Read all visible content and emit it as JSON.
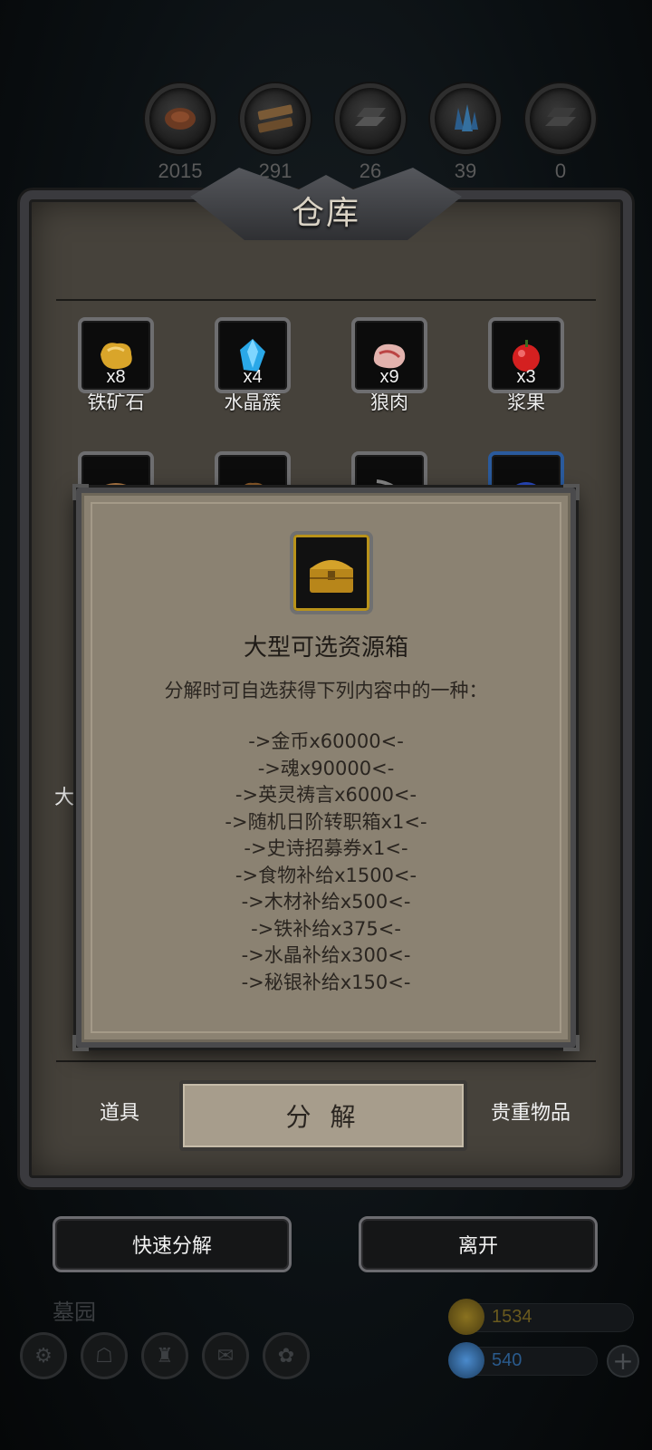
{
  "resources": [
    {
      "icon": "meat-icon",
      "count": "2015",
      "color": "#6b3a22"
    },
    {
      "icon": "wood-icon",
      "count": "291",
      "color": "#7a5a36"
    },
    {
      "icon": "iron-icon",
      "count": "26",
      "color": "#555555"
    },
    {
      "icon": "crystal-icon",
      "count": "39",
      "color": "#2b5d8c"
    },
    {
      "icon": "mithril-icon",
      "count": "0",
      "color": "#444444"
    }
  ],
  "warehouse": {
    "title": "仓库",
    "items": [
      {
        "name": "铁矿石",
        "qty": "x8",
        "icon": "iron-ore-icon",
        "color": "#d9a52a"
      },
      {
        "name": "水晶簇",
        "qty": "x4",
        "icon": "crystal-cluster-icon",
        "color": "#2aa8e8"
      },
      {
        "name": "狼肉",
        "qty": "x9",
        "icon": "wolf-meat-icon",
        "color": "#e3b3ae"
      },
      {
        "name": "浆果",
        "qty": "x3",
        "icon": "berry-icon",
        "color": "#d42020"
      }
    ],
    "partial_left_label": "大型"
  },
  "tabs": {
    "items": "道具",
    "decompose": "分 解",
    "valuables": "贵重物品"
  },
  "buttons": {
    "quick_decompose": "快速分解",
    "leave": "离开"
  },
  "footer": {
    "area_name": "墓园",
    "gold": "1534",
    "gems": "540",
    "plus": "+"
  },
  "modal": {
    "icon": "treasure-chest-icon",
    "title": "大型可选资源箱",
    "description": "分解时可自选获得下列内容中的一种：",
    "options": [
      "->金币x60000<-",
      "->魂x90000<-",
      "->英灵祷言x6000<-",
      "->随机日阶转职箱x1<-",
      "->史诗招募券x1<-",
      "->食物补给x1500<-",
      "->木材补给x500<-",
      "->铁补给x375<-",
      "->水晶补给x300<-",
      "->秘银补给x150<-"
    ]
  },
  "colors": {
    "panel": "#46423b",
    "modal_bg": "#8b8272",
    "gold": "#8a7220",
    "gem": "#2a5a8c"
  }
}
